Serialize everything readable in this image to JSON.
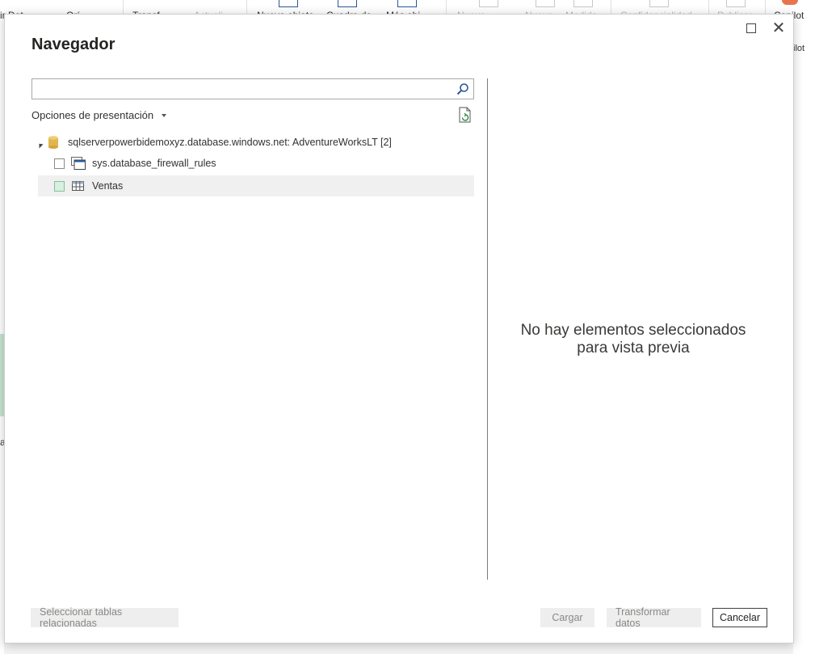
{
  "background": {
    "ribbon_fragments": [
      "ir Dat",
      "Orí",
      "Transf",
      "Actuali",
      "Nuevo objeto",
      "Cuadro de",
      "Más obj",
      "Nueva",
      "Nueva",
      "Medida",
      "Confidencialidad",
      "Publicar",
      "Copilot"
    ],
    "copilot_label": "Copilot",
    "copilot_group": "ilot",
    "left_fragment": "a"
  },
  "dialog": {
    "title": "Navegador",
    "search": {
      "value": "",
      "placeholder": ""
    },
    "display_options_label": "Opciones de presentación",
    "tree": {
      "root_label": "sqlserverpowerbidemoxyz.database.windows.net: AdventureWorksLT [2]",
      "items": [
        {
          "label": "sys.database_firewall_rules",
          "icon": "view-icon",
          "checked": false
        },
        {
          "label": "Ventas",
          "icon": "table-icon",
          "checked": false,
          "hovered": true
        }
      ]
    },
    "preview_message_line1": "No hay elementos seleccionados",
    "preview_message_line2": "para vista previa",
    "buttons": {
      "select_related": "Seleccionar tablas relacionadas",
      "load": "Cargar",
      "transform": "Transformar datos",
      "cancel": "Cancelar"
    }
  },
  "colors": {
    "accent": "#2b579a",
    "db_icon": "#e0b64f",
    "hover_row": "#f0f0f0",
    "checkbox_hover": "#d9efe0"
  }
}
